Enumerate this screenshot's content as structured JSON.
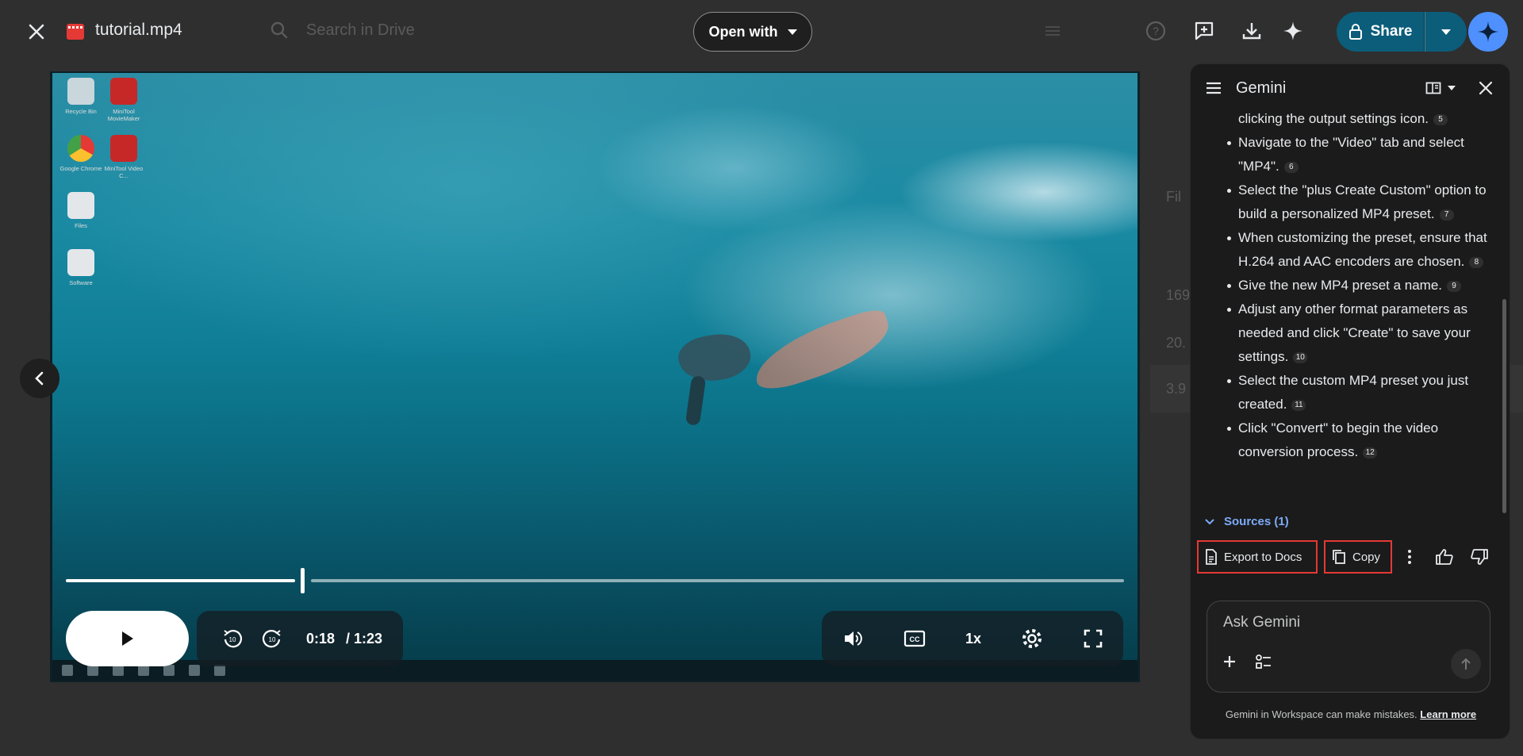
{
  "topbar": {
    "file_name": "tutorial.mp4",
    "search_placeholder": "Search in Drive",
    "open_with_label": "Open with",
    "share_label": "Share"
  },
  "video": {
    "current_time": "0:18",
    "duration": "/ 1:23",
    "progress_fraction": 0.217,
    "speed_label": "1x",
    "desktop_icons": [
      {
        "label": "Recycle Bin"
      },
      {
        "label": "MiniTool MovieMaker"
      },
      {
        "label": "Google Chrome"
      },
      {
        "label": "MiniTool Video C..."
      },
      {
        "label": "Files"
      },
      {
        "label": "Software"
      }
    ]
  },
  "gemini": {
    "title": "Gemini",
    "items": [
      {
        "text": "clicking the output settings icon.",
        "cite": "5",
        "continuation": true
      },
      {
        "text": "Navigate to the \"Video\" tab and select \"MP4\".",
        "cite": "6"
      },
      {
        "text": "Select the \"plus Create Custom\" option to build a personalized MP4 preset.",
        "cite": "7"
      },
      {
        "text": "When customizing the preset, ensure that H.264 and AAC encoders are chosen.",
        "cite": "8"
      },
      {
        "text": "Give the new MP4 preset a name.",
        "cite": "9"
      },
      {
        "text": "Adjust any other format parameters as needed and click \"Create\" to save your settings.",
        "cite": "10"
      },
      {
        "text": "Select the custom MP4 preset you just created.",
        "cite": "11"
      },
      {
        "text": "Click \"Convert\" to begin the video conversion process.",
        "cite": "12"
      }
    ],
    "sources_label": "Sources (1)",
    "export_label": "Export to Docs",
    "copy_label": "Copy",
    "ask_placeholder": "Ask Gemini",
    "disclaimer": "Gemini in Workspace can make mistakes.",
    "learn_more": "Learn more"
  },
  "colors": {
    "accent_blue": "#4d90fe",
    "share_bg": "#0b5d7a",
    "highlight_red": "#e53935"
  }
}
